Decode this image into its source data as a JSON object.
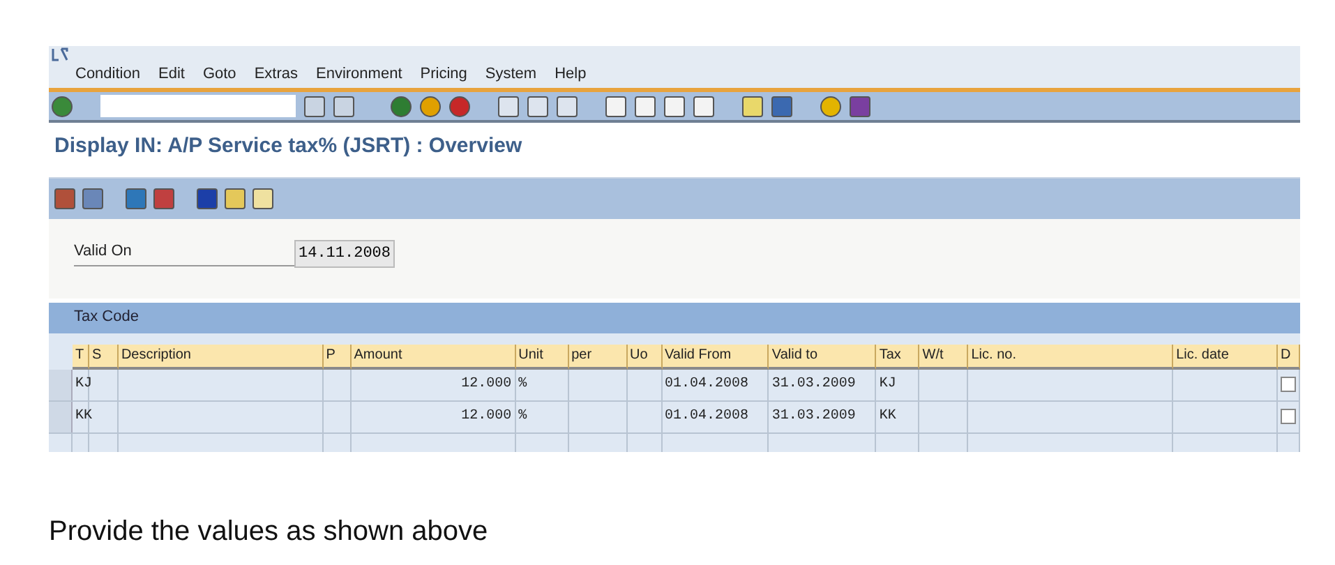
{
  "menu": [
    "Condition",
    "Edit",
    "Goto",
    "Extras",
    "Environment",
    "Pricing",
    "System",
    "Help"
  ],
  "title": "Display IN: A/P Service tax% (JSRT) : Overview",
  "field": {
    "label": "Valid On",
    "value": "14.11.2008"
  },
  "table": {
    "title": "Tax Code",
    "columns": [
      "T",
      "S",
      "Description",
      "P",
      "Amount",
      "Unit",
      "per",
      "Uo",
      "Valid From",
      "Valid to",
      "Tax",
      "W/t",
      "Lic. no.",
      "Lic. date",
      "D"
    ],
    "rows": [
      {
        "cells": [
          "KJ",
          "",
          "",
          "",
          "12.000",
          "%",
          "",
          "",
          "01.04.2008",
          "31.03.2009",
          "KJ",
          "",
          "",
          "",
          ""
        ],
        "checked": false
      },
      {
        "cells": [
          "KK",
          "",
          "",
          "",
          "12.000",
          "%",
          "",
          "",
          "01.04.2008",
          "31.03.2009",
          "KK",
          "",
          "",
          "",
          ""
        ],
        "checked": false
      }
    ]
  },
  "caption": "Provide the values as shown above"
}
